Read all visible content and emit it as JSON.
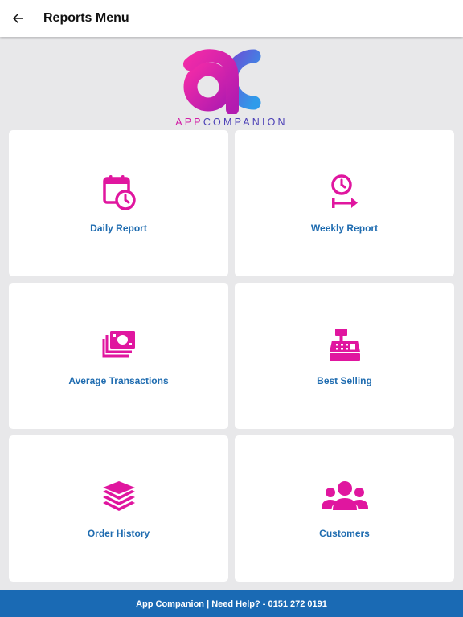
{
  "header": {
    "title": "Reports Menu",
    "back_icon": "arrow-left-icon"
  },
  "logo": {
    "app_part": "APP",
    "companion_part": "COMPANION"
  },
  "menu": [
    {
      "label": "Daily Report",
      "icon": "calendar-clock-icon"
    },
    {
      "label": "Weekly Report",
      "icon": "clock-arrow-icon"
    },
    {
      "label": "Average Transactions",
      "icon": "money-stack-icon"
    },
    {
      "label": "Best Selling",
      "icon": "cash-register-icon"
    },
    {
      "label": "Order History",
      "icon": "layers-icon"
    },
    {
      "label": "Customers",
      "icon": "users-icon"
    }
  ],
  "footer": {
    "text": "App Companion | Need Help? - 0151 272 0191"
  },
  "colors": {
    "icon": "#e0169f",
    "label": "#1f6cb0",
    "footer_bg": "#1a6ab4",
    "page_bg": "#e8e8ea"
  }
}
